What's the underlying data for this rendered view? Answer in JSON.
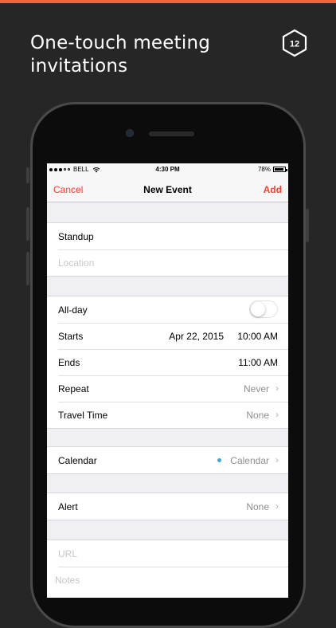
{
  "headline": {
    "line1": "One-touch meeting",
    "line2": "invitations"
  },
  "logo": {
    "text": "12",
    "icon": "hexagon-12-logo"
  },
  "colors": {
    "accent": "#f2663a",
    "ios_red": "#ff3b30",
    "calendar_dot": "#34aadc"
  },
  "status_bar": {
    "signal": "●●●○○",
    "carrier": "BELL",
    "wifi_icon": "wifi-icon",
    "time": "4:30 PM",
    "battery": "78%",
    "battery_level": 0.78
  },
  "nav": {
    "cancel": "Cancel",
    "title": "New Event",
    "add": "Add"
  },
  "form": {
    "title_value": "Standup",
    "location_placeholder": "Location",
    "allday_label": "All-day",
    "allday_on": false,
    "starts_label": "Starts",
    "starts_date": "Apr 22, 2015",
    "starts_time": "10:00 AM",
    "ends_label": "Ends",
    "ends_time": "11:00 AM",
    "repeat_label": "Repeat",
    "repeat_value": "Never",
    "travel_label": "Travel Time",
    "travel_value": "None",
    "calendar_label": "Calendar",
    "calendar_value": "Calendar",
    "alert_label": "Alert",
    "alert_value": "None",
    "url_placeholder": "URL",
    "notes_placeholder": "Notes"
  }
}
